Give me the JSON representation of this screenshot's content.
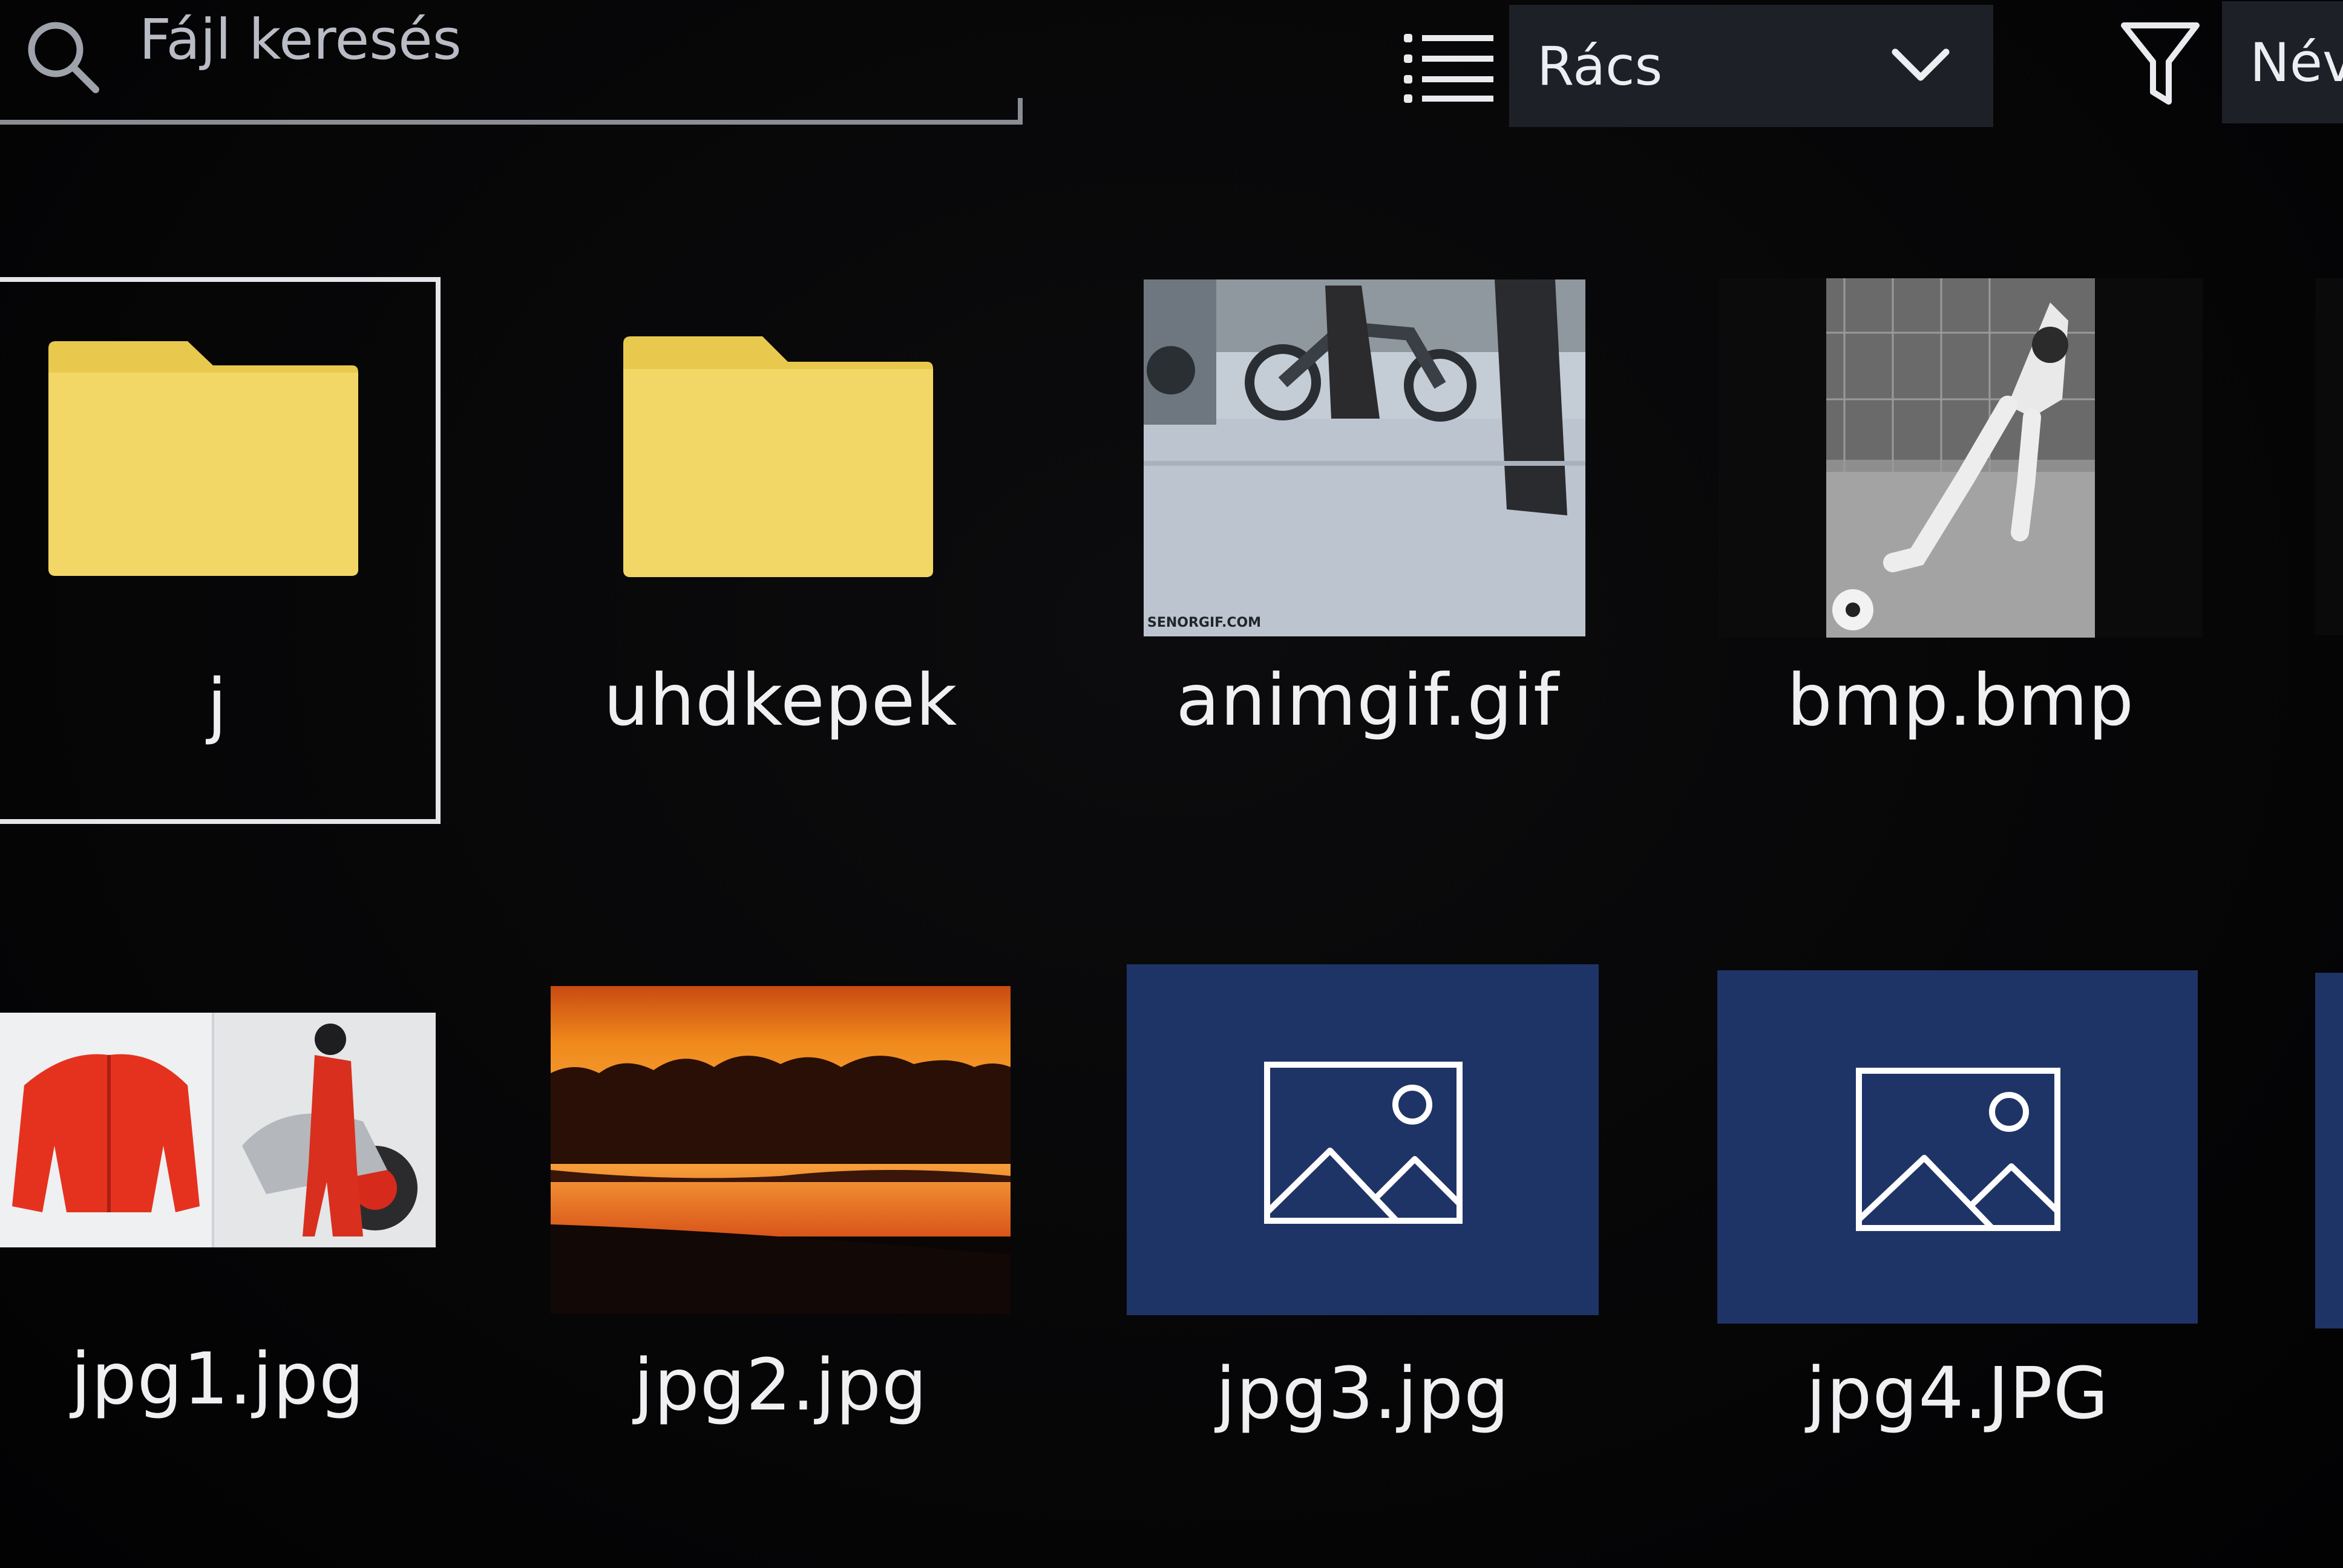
{
  "search": {
    "placeholder": "Fájl keresés"
  },
  "toolbar": {
    "view_mode": "Rács",
    "sort_label": "Név"
  },
  "items": [
    {
      "name": "j",
      "kind": "folder",
      "focused": true
    },
    {
      "name": "uhdkepek",
      "kind": "folder"
    },
    {
      "name": "animgif.gif",
      "kind": "image",
      "watermark": "SENORGIF.COM"
    },
    {
      "name": "bmp.bmp",
      "kind": "image"
    },
    {
      "name": "jpg1.jpg",
      "kind": "image"
    },
    {
      "name": "jpg2.jpg",
      "kind": "image"
    },
    {
      "name": "jpg3.jpg",
      "kind": "image-placeholder"
    },
    {
      "name": "jpg4.JPG",
      "kind": "image-placeholder"
    }
  ],
  "colors": {
    "background": "#050506",
    "folder": "#f2d766",
    "folder_tab": "#e8c94e",
    "placeholder_tile": "#1f3466",
    "dropdown": "#1d2026",
    "focus_border": "#e6e6ea"
  }
}
